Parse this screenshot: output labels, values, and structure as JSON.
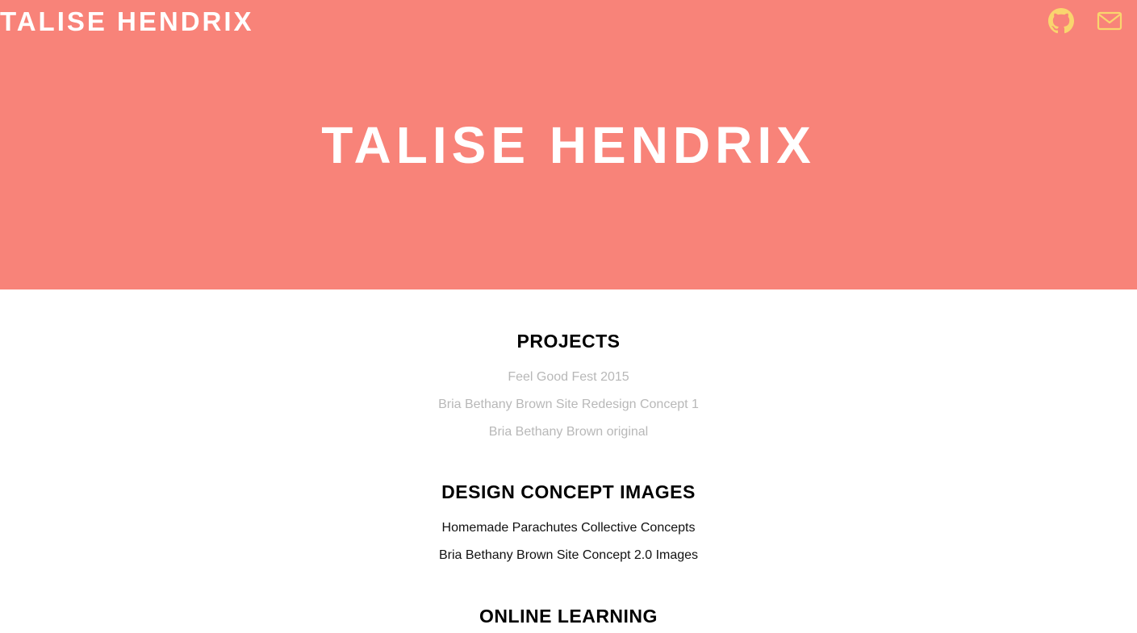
{
  "header": {
    "brand": "TALISE HENDRIX",
    "icons": {
      "github": "github-icon",
      "mail": "mail-icon",
      "color": "#f9d56e"
    }
  },
  "hero": {
    "title": "TALISE HENDRIX",
    "background": "#f88379"
  },
  "sections": [
    {
      "heading": "PROJECTS",
      "links": [
        "Feel Good Fest 2015",
        "Bria Bethany Brown Site Redesign Concept 1",
        "Bria Bethany Brown original"
      ]
    },
    {
      "heading": "DESIGN CONCEPT IMAGES",
      "links": [
        "Homemade Parachutes Collective Concepts",
        "Bria Bethany Brown Site Concept 2.0 Images"
      ]
    },
    {
      "heading": "ONLINE LEARNING",
      "links": []
    }
  ]
}
